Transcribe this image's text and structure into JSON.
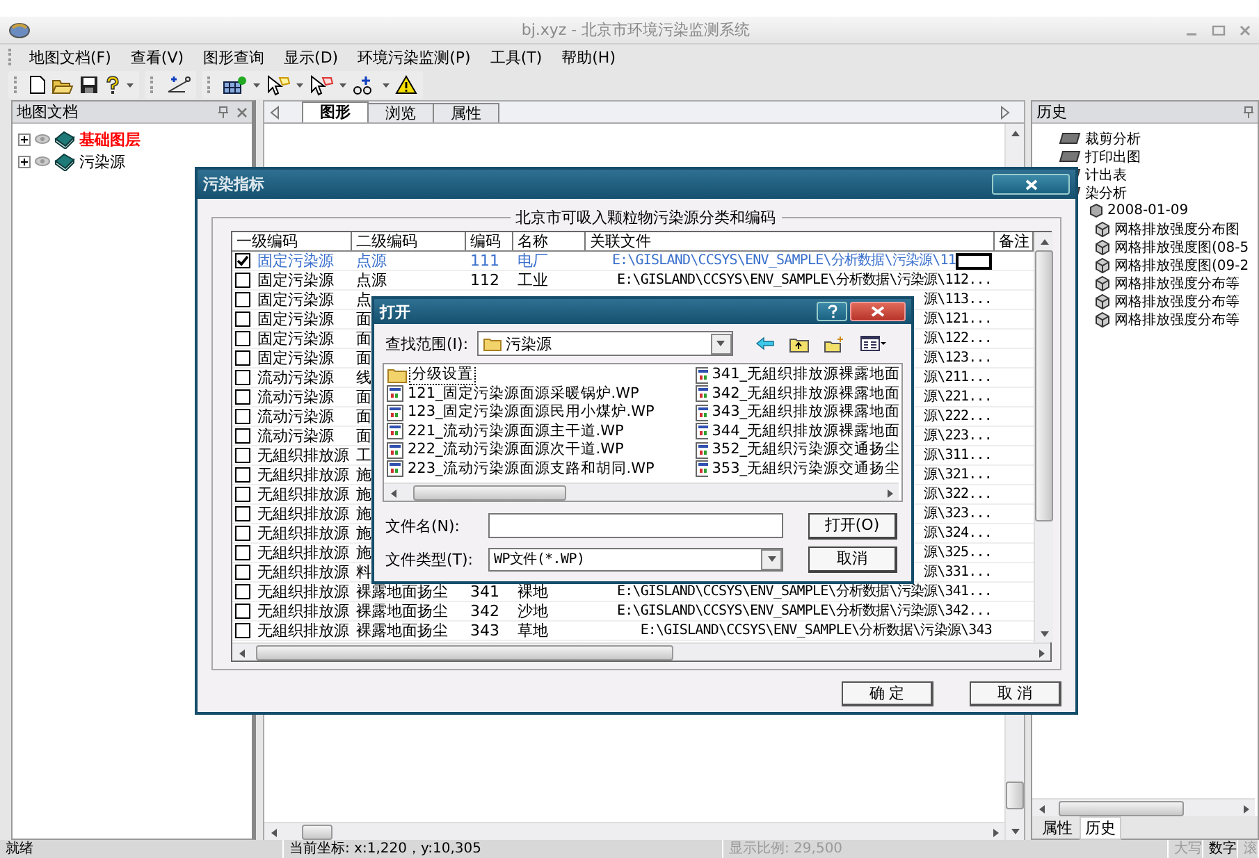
{
  "window": {
    "title": "bj.xyz - 北京市环境污染监测系统"
  },
  "menu": [
    {
      "label": "地图文档(F)"
    },
    {
      "label": "查看(V)"
    },
    {
      "label": "图形查询"
    },
    {
      "label": "显示(D)"
    },
    {
      "label": "环境污染监测(P)"
    },
    {
      "label": "工具(T)"
    },
    {
      "label": "帮助(H)"
    }
  ],
  "left_panel": {
    "title": "地图文档",
    "layers": [
      {
        "label": "基础图层",
        "highlighted": true
      },
      {
        "label": "污染源",
        "highlighted": false
      }
    ]
  },
  "tabs": [
    {
      "label": "图形",
      "selected": true
    },
    {
      "label": "浏览",
      "selected": false
    },
    {
      "label": "属性",
      "selected": false
    }
  ],
  "history_panel": {
    "title": "历史",
    "items": [
      {
        "label": "裁剪分析",
        "kind": "action"
      },
      {
        "label": "打印出图",
        "kind": "action"
      },
      {
        "label": "计出表",
        "kind": "action"
      },
      {
        "label": "染分析",
        "kind": "action",
        "children": [
          {
            "label": "2008-01-09",
            "kind": "date",
            "children": [
              {
                "label": "网格排放强度分布图",
                "kind": "result"
              },
              {
                "label": "网格排放强度图(08-5",
                "kind": "result"
              },
              {
                "label": "网格排放强度图(09-2",
                "kind": "result"
              },
              {
                "label": "网格排放强度分布等",
                "kind": "result"
              },
              {
                "label": "网格排放强度分布等",
                "kind": "result"
              },
              {
                "label": "网格排放强度分布等",
                "kind": "result"
              }
            ]
          }
        ]
      }
    ],
    "bottom_tabs": [
      {
        "label": "属性",
        "selected": false
      },
      {
        "label": "历史",
        "selected": true
      }
    ]
  },
  "status_bar": [
    {
      "text": "就绪",
      "disabled": false
    },
    {
      "text": "当前坐标: x:1,220，y:10,305",
      "disabled": false
    },
    {
      "text": "显示比例: 29,500",
      "disabled": true
    },
    {
      "text": "大写",
      "disabled": true
    },
    {
      "text": "数字",
      "disabled": false
    },
    {
      "text": "滚",
      "disabled": true
    }
  ],
  "index_dialog": {
    "title": "污染指标",
    "group_title": "北京市可吸入颗粒物污染源分类和编码",
    "columns": [
      "一级编码",
      "二级编码",
      "编码",
      "名称",
      "关联文件",
      "备注"
    ],
    "rows": [
      {
        "checked": true,
        "selected": true,
        "editing": true,
        "l1": "固定污染源",
        "l2": "点源",
        "code": "111",
        "name": "电厂",
        "file": "E:\\GISLAND\\CCSYS\\ENV_SAMPLE\\分析数据\\污染源\\11"
      },
      {
        "checked": false,
        "selected": false,
        "editing": false,
        "l1": "固定污染源",
        "l2": "点源",
        "code": "112",
        "name": "工业",
        "file": "E:\\GISLAND\\CCSYS\\ENV_SAMPLE\\分析数据\\污染源\\112..."
      },
      {
        "checked": false,
        "selected": false,
        "editing": false,
        "l1": "固定污染源",
        "l2": "点",
        "file": "源\\113..."
      },
      {
        "checked": false,
        "selected": false,
        "editing": false,
        "l1": "固定污染源",
        "l2": "面",
        "file": "源\\121..."
      },
      {
        "checked": false,
        "selected": false,
        "editing": false,
        "l1": "固定污染源",
        "l2": "面",
        "file": "源\\122..."
      },
      {
        "checked": false,
        "selected": false,
        "editing": false,
        "l1": "固定污染源",
        "l2": "面",
        "file": "源\\123..."
      },
      {
        "checked": false,
        "selected": false,
        "editing": false,
        "l1": "流动污染源",
        "l2": "线",
        "file": "源\\211..."
      },
      {
        "checked": false,
        "selected": false,
        "editing": false,
        "l1": "流动污染源",
        "l2": "面",
        "file": "源\\221..."
      },
      {
        "checked": false,
        "selected": false,
        "editing": false,
        "l1": "流动污染源",
        "l2": "面",
        "file": "源\\222..."
      },
      {
        "checked": false,
        "selected": false,
        "editing": false,
        "l1": "流动污染源",
        "l2": "面",
        "file": "源\\223..."
      },
      {
        "checked": false,
        "selected": false,
        "editing": false,
        "l1": "无組织排放源",
        "l2": "工",
        "file": "源\\311..."
      },
      {
        "checked": false,
        "selected": false,
        "editing": false,
        "l1": "无組织排放源",
        "l2": "施",
        "file": "源\\321..."
      },
      {
        "checked": false,
        "selected": false,
        "editing": false,
        "l1": "无組织排放源",
        "l2": "施",
        "file": "源\\322..."
      },
      {
        "checked": false,
        "selected": false,
        "editing": false,
        "l1": "无組织排放源",
        "l2": "施",
        "file": "源\\323..."
      },
      {
        "checked": false,
        "selected": false,
        "editing": false,
        "l1": "无組织排放源",
        "l2": "施",
        "file": "源\\324..."
      },
      {
        "checked": false,
        "selected": false,
        "editing": false,
        "l1": "无組织排放源",
        "l2": "施",
        "file": "源\\325..."
      },
      {
        "checked": false,
        "selected": false,
        "editing": false,
        "l1": "无組织排放源",
        "l2": "料",
        "file": "源\\331..."
      },
      {
        "checked": false,
        "selected": false,
        "editing": false,
        "l1": "无組织排放源",
        "l2": "裸露地面扬尘",
        "code": "341",
        "name": "裸地",
        "file": "E:\\GISLAND\\CCSYS\\ENV_SAMPLE\\分析数据\\污染源\\341..."
      },
      {
        "checked": false,
        "selected": false,
        "editing": false,
        "l1": "无組织排放源",
        "l2": "裸露地面扬尘",
        "code": "342",
        "name": "沙地",
        "file": "E:\\GISLAND\\CCSYS\\ENV_SAMPLE\\分析数据\\污染源\\342..."
      },
      {
        "checked": false,
        "selected": false,
        "editing": false,
        "l1": "无組织排放源",
        "l2": "裸露地面扬尘",
        "code": "343",
        "name": "草地",
        "file": "E:\\GISLAND\\CCSYS\\ENV_SAMPLE\\分析数据\\污染源\\343"
      }
    ],
    "buttons": [
      "确 定",
      "取 消"
    ]
  },
  "open_dialog": {
    "title": "打开",
    "look_in_label": "查找范围(I):",
    "look_in": "污染源",
    "files": [
      {
        "name": "分级设置",
        "kind": "folder",
        "selected": true
      },
      {
        "name": "121_固定污染源面源采暖锅炉.WP",
        "kind": "file",
        "selected": false
      },
      {
        "name": "123_固定污染源面源民用小煤炉.WP",
        "kind": "file",
        "selected": false
      },
      {
        "name": "221_流动污染源面源主干道.WP",
        "kind": "file",
        "selected": false
      },
      {
        "name": "222_流动污染源面源次干道.WP",
        "kind": "file",
        "selected": false
      },
      {
        "name": "223_流动污染源面源支路和胡同.WP",
        "kind": "file",
        "selected": false
      },
      {
        "name": "341_无組织排放源裸露地面",
        "kind": "file",
        "selected": false
      },
      {
        "name": "342_无組织排放源裸露地面",
        "kind": "file",
        "selected": false
      },
      {
        "name": "343_无組织排放源裸露地面",
        "kind": "file",
        "selected": false
      },
      {
        "name": "344_无組织排放源裸露地面",
        "kind": "file",
        "selected": false
      },
      {
        "name": "352_无組织污染源交通扬尘",
        "kind": "file",
        "selected": false
      },
      {
        "name": "353_无組织污染源交通扬尘",
        "kind": "file",
        "selected": false
      }
    ],
    "filename_label": "文件名(N):",
    "filetype_label": "文件类型(T):",
    "filetype": "WP文件(*.WP)",
    "buttons": [
      "打开(O)",
      "取消"
    ]
  }
}
